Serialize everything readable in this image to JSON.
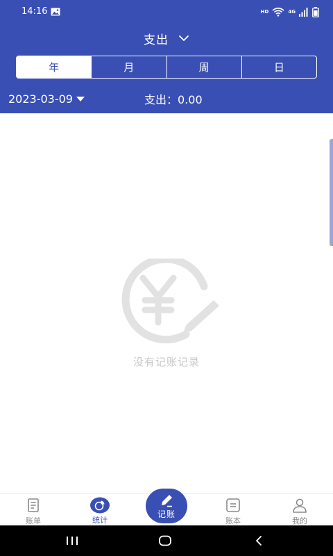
{
  "status_bar": {
    "time": "14:16",
    "image_icon": "image-icon",
    "hd_label": "HD",
    "network_label": "4G",
    "wifi_icon": "wifi-icon",
    "signal_icon": "signal-icon",
    "battery_icon": "battery-icon"
  },
  "header": {
    "title": "支出",
    "title_icon": "chevron-down-icon",
    "tabs": [
      {
        "label": "年",
        "active": true
      },
      {
        "label": "月",
        "active": false
      },
      {
        "label": "周",
        "active": false
      },
      {
        "label": "日",
        "active": false
      }
    ],
    "date": "2023-03-09",
    "date_icon": "caret-down-icon",
    "expense_total": "支出：0.00"
  },
  "empty_state": {
    "icon": "yen-pencil-icon",
    "message": "没有记账记录"
  },
  "bottom_nav": {
    "items": [
      {
        "label": "账单",
        "icon": "bill-icon",
        "active": false
      },
      {
        "label": "统计",
        "icon": "pie-chart-icon",
        "active": true
      },
      {
        "label": "记账",
        "icon": "pencil-icon",
        "active": false
      },
      {
        "label": "账本",
        "icon": "ledger-icon",
        "active": false
      },
      {
        "label": "我的",
        "icon": "user-icon",
        "active": false
      }
    ]
  },
  "system_nav": {
    "recents_icon": "recents-icon",
    "home_icon": "home-icon",
    "back_icon": "back-icon"
  },
  "colors": {
    "primary": "#3a4fb3",
    "inactive_text": "#8a8a8a",
    "empty_text": "#c8c8c8"
  }
}
